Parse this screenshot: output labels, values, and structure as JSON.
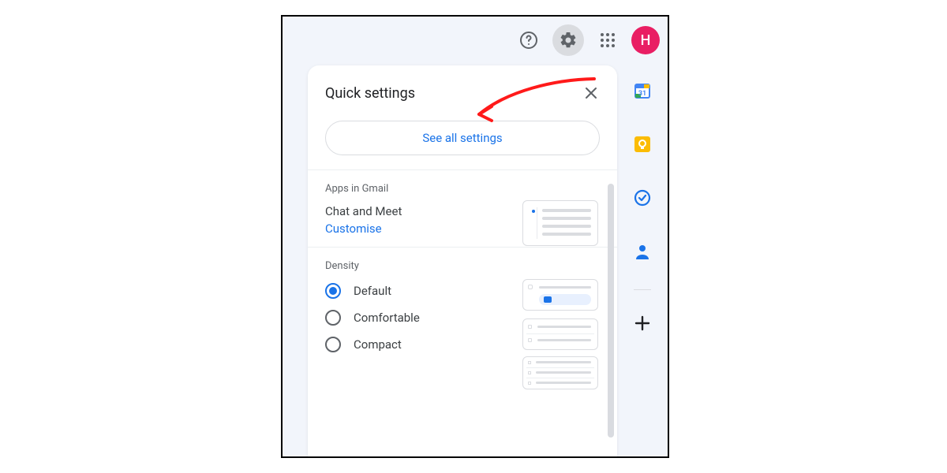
{
  "topbar": {
    "avatar_initial": "H"
  },
  "panel": {
    "title": "Quick settings",
    "see_all": "See all settings"
  },
  "apps_section": {
    "title": "Apps in Gmail",
    "subtitle": "Chat and Meet",
    "link": "Customise"
  },
  "density": {
    "title": "Density",
    "options": {
      "0": {
        "label": "Default",
        "selected": true
      },
      "1": {
        "label": "Comfortable",
        "selected": false
      },
      "2": {
        "label": "Compact",
        "selected": false
      }
    }
  },
  "colors": {
    "link": "#1a73e8",
    "avatar": "#e91e63",
    "keep": "#fbbc04"
  }
}
